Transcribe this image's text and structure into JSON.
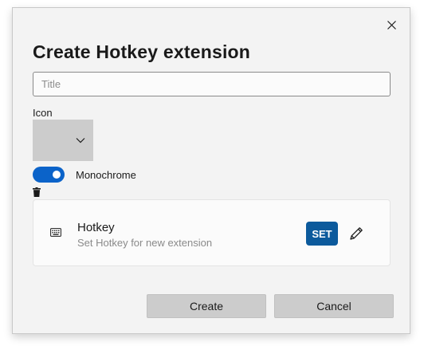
{
  "dialog": {
    "title": "Create Hotkey extension",
    "close_icon": "close-icon"
  },
  "title_field": {
    "placeholder": "Title",
    "value": ""
  },
  "icon_section": {
    "label": "Icon",
    "picker_icon": "chevron-down-icon"
  },
  "monochrome": {
    "label": "Monochrome",
    "on": true,
    "accent": "#0b63c9"
  },
  "trash_icon": "trash-icon",
  "hotkey_card": {
    "title": "Hotkey",
    "description": "Set Hotkey for new extension",
    "icon": "keyboard-icon",
    "set_label": "SET",
    "set_color": "#0c5a9c",
    "edit_icon": "pencil-icon"
  },
  "actions": {
    "create_label": "Create",
    "cancel_label": "Cancel"
  }
}
